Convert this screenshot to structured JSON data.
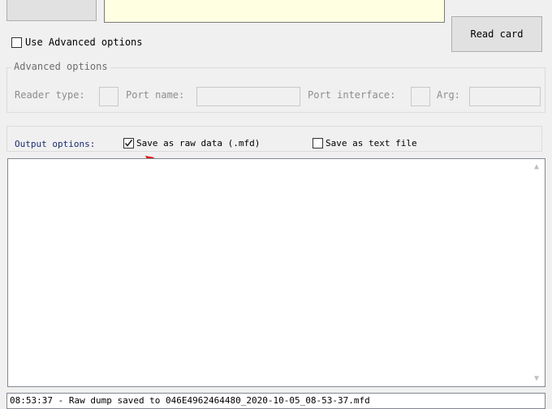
{
  "reader": {
    "read_label": "Read card"
  },
  "advanced": {
    "use_label": "Use Advanced options",
    "use_checked": false,
    "group_title": "Advanced options",
    "reader_type_label": "Reader type:",
    "port_name_label": "Port name:",
    "port_interface_label": "Port interface:",
    "arg_label": "Arg:"
  },
  "output": {
    "label": "Output options:",
    "raw_label": "Save as raw data (.mfd)",
    "raw_checked": true,
    "text_label": "Save as text file",
    "text_checked": false
  },
  "log": {
    "content": ""
  },
  "status": {
    "message": "08:53:37 - Raw dump saved to 046E4962464480_2020-10-05_08-53-37.mfd"
  },
  "colors": {
    "annotation_arrow": "#e01010",
    "window_bg": "#f0f0f0",
    "link_text": "#1c2a6d"
  },
  "icons": {
    "raw_check": "check-mark",
    "annotation": "red-pointer-arrow",
    "scroll_up": "chevron-up",
    "scroll_down": "chevron-down"
  }
}
